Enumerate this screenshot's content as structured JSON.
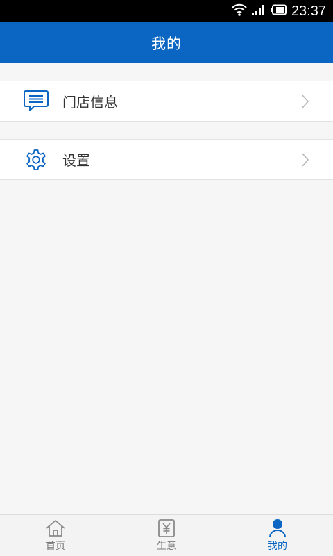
{
  "status_bar": {
    "time": "23:37"
  },
  "header": {
    "title": "我的"
  },
  "menu": {
    "items": [
      {
        "label": "门店信息",
        "icon": "message-icon"
      },
      {
        "label": "设置",
        "icon": "gear-icon"
      }
    ]
  },
  "tabs": [
    {
      "label": "首页",
      "icon": "home-icon",
      "active": false
    },
    {
      "label": "生意",
      "icon": "yuan-icon",
      "active": false
    },
    {
      "label": "我的",
      "icon": "person-icon",
      "active": true
    }
  ],
  "colors": {
    "primary": "#0a66c2",
    "background": "#f6f6f6",
    "text": "#333333",
    "tab_inactive": "#7a7a7a"
  }
}
